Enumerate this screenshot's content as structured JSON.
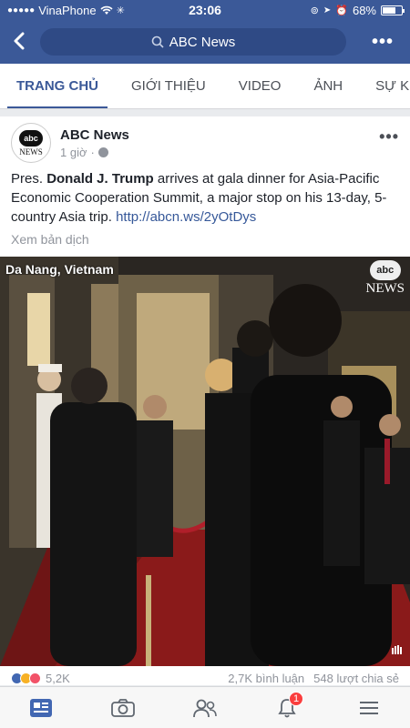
{
  "status_bar": {
    "carrier": "VinaPhone",
    "time": "23:06",
    "battery": "68%",
    "battery_level": 0.68
  },
  "header": {
    "back_icon": "chevron-left-icon",
    "search_text": "ABC News",
    "more_icon": "more-dots-icon"
  },
  "tabs": [
    {
      "label": "TRANG CHỦ",
      "active": true
    },
    {
      "label": "GIỚI THIỆU",
      "active": false
    },
    {
      "label": "VIDEO",
      "active": false
    },
    {
      "label": "ẢNH",
      "active": false
    },
    {
      "label": "SỰ K",
      "active": false
    }
  ],
  "post": {
    "page_name": "ABC News",
    "avatar_abc": "abc",
    "avatar_news": "NEWS",
    "time": "1 giờ",
    "text_prefix": "Pres. ",
    "text_bold": "Donald J. Trump",
    "text_body": " arrives at gala dinner for Asia-Pacific Economic Cooperation Summit, a major stop on his 13-day, 5-country Asia trip. ",
    "link": "http://abcn.ws/2yOtDys",
    "translate": "Xem bản dịch",
    "video": {
      "location_caption": "Da Nang, Vietnam",
      "logo_abc": "abc",
      "logo_news": "NEWS"
    },
    "reactions": {
      "count": "5,2K",
      "comments": "2,7K bình luận",
      "shares": "548 lượt chia sẻ"
    }
  },
  "bottom_nav": {
    "notifications_badge": "1",
    "icons": [
      "news-feed-icon",
      "camera-icon",
      "friends-icon",
      "notifications-icon",
      "menu-icon"
    ]
  },
  "colors": {
    "brand": "#3b5998",
    "badge": "#fa3e3e"
  }
}
